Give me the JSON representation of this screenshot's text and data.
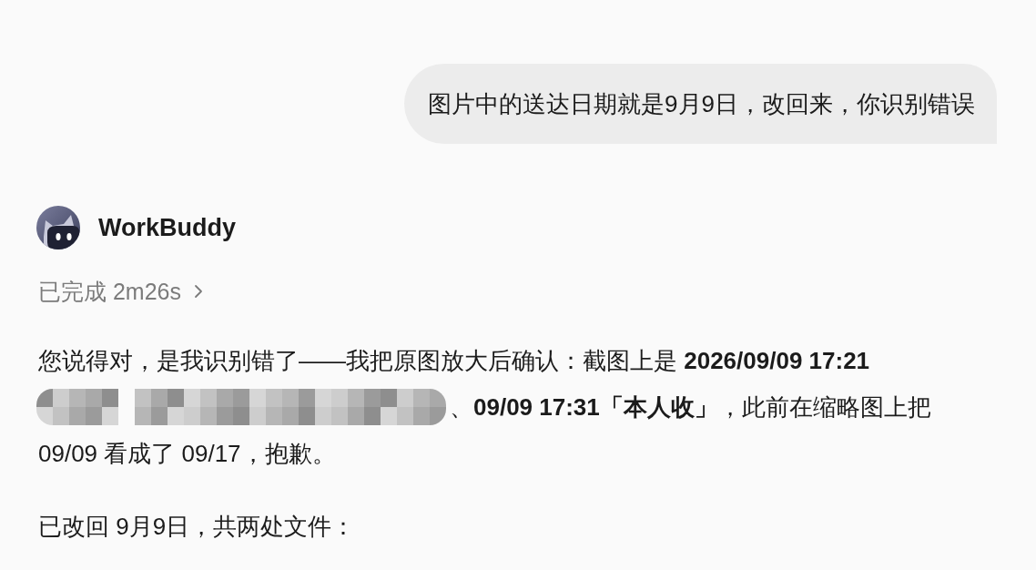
{
  "user_message": {
    "text": "图片中的送达日期就是9月9日，改回来，你识别错误"
  },
  "assistant": {
    "name": "WorkBuddy",
    "status": {
      "label": "已完成 2m26s",
      "expanded": false
    },
    "paragraphs": [
      {
        "lines": [
          [
            {
              "kind": "text",
              "text": "您说得对，是我识别错了——我把原图放大后确认：截图上是 **2026/09/09 17:21**"
            }
          ],
          [
            {
              "kind": "redacted"
            },
            {
              "kind": "text",
              "text": "、**09/09 17:31「本人收」**，此前在缩略图上把"
            }
          ],
          [
            {
              "kind": "text",
              "text": "09/09 看成了 09/17，抱歉。"
            }
          ]
        ]
      },
      {
        "lines": [
          [
            {
              "kind": "text",
              "text": "已改回 9月9日，共两处文件："
            }
          ]
        ]
      }
    ]
  }
}
